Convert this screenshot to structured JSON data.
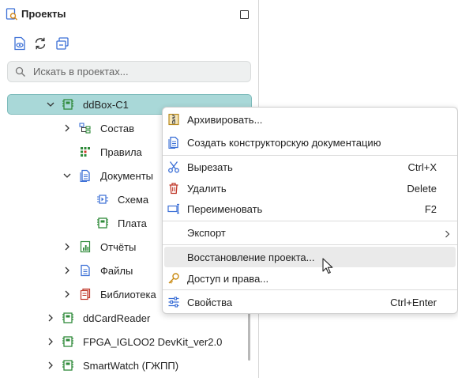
{
  "panel": {
    "title": "Проекты",
    "search_placeholder": "Искать в проектах..."
  },
  "tree": [
    {
      "label": "ddBox-C1",
      "icon": "project-board-icon",
      "selected": true,
      "expanded": true
    },
    {
      "label": "Состав",
      "icon": "hierarchy-icon"
    },
    {
      "label": "Правила",
      "icon": "rules-grid-icon"
    },
    {
      "label": "Документы",
      "icon": "documents-icon",
      "expanded": true
    },
    {
      "label": "Схема",
      "icon": "schematic-icon"
    },
    {
      "label": "Плата",
      "icon": "board-icon"
    },
    {
      "label": "Отчёты",
      "icon": "reports-icon"
    },
    {
      "label": "Файлы",
      "icon": "file-icon"
    },
    {
      "label": "Библиотека",
      "icon": "library-icon"
    },
    {
      "label": "ddCardReader",
      "icon": "project-board-icon"
    },
    {
      "label": "FPGA_IGLOO2 DevKit_ver2.0",
      "icon": "project-board-icon"
    },
    {
      "label": "SmartWatch (ГЖПП)",
      "icon": "project-board-icon"
    }
  ],
  "context_menu": {
    "items": [
      {
        "label": "Архивировать...",
        "icon": "archive-icon",
        "shortcut": ""
      },
      {
        "label": "Создать конструкторскую документацию",
        "icon": "create-docs-icon",
        "shortcut": ""
      },
      {
        "label": "Вырезать",
        "icon": "cut-icon",
        "shortcut": "Ctrl+X"
      },
      {
        "label": "Удалить",
        "icon": "delete-icon",
        "shortcut": "Delete"
      },
      {
        "label": "Переименовать",
        "icon": "rename-icon",
        "shortcut": "F2"
      },
      {
        "label": "Экспорт",
        "icon": "",
        "shortcut": ""
      },
      {
        "label": "Восстановление проекта...",
        "icon": "",
        "shortcut": ""
      },
      {
        "label": "Доступ и права...",
        "icon": "key-icon",
        "shortcut": ""
      },
      {
        "label": "Свойства",
        "icon": "properties-icon",
        "shortcut": "Ctrl+Enter"
      }
    ]
  },
  "colors": {
    "selection": "#a9d8d8",
    "accent_blue": "#3b6fd6",
    "accent_green": "#2f8a3a",
    "accent_red": "#c0392b"
  }
}
